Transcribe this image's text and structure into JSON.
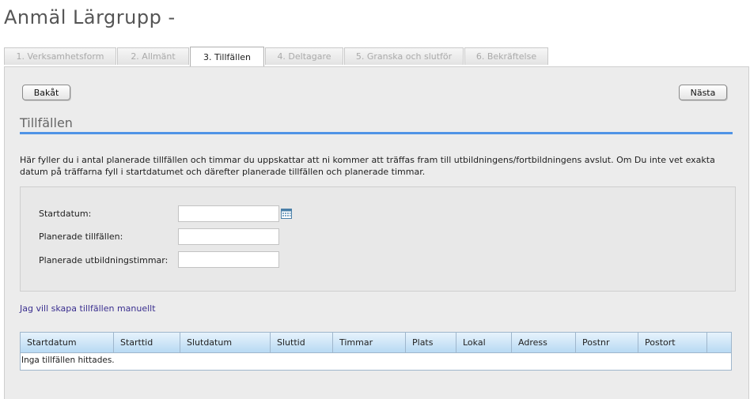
{
  "page": {
    "title": "Anmäl Lärgrupp -"
  },
  "tabs": [
    {
      "label": "1. Verksamhetsform",
      "active": false
    },
    {
      "label": "2. Allmänt",
      "active": false
    },
    {
      "label": "3. Tillfällen",
      "active": true
    },
    {
      "label": "4. Deltagare",
      "active": false
    },
    {
      "label": "5. Granska och slutför",
      "active": false
    },
    {
      "label": "6. Bekräftelse",
      "active": false
    }
  ],
  "nav": {
    "back_label": "Bakåt",
    "next_label": "Nästa"
  },
  "section": {
    "title": "Tillfällen",
    "intro": "Här fyller du i antal planerade tillfällen och timmar du uppskattar att ni kommer att träffas fram till utbildningens/fortbildningens avslut. Om Du inte vet exakta datum på träffarna fyll i startdatumet och därefter planerade tillfällen och planerade timmar."
  },
  "form": {
    "start_date_label": "Startdatum:",
    "start_date_value": "",
    "planned_sessions_label": "Planerade tillfällen:",
    "planned_sessions_value": "",
    "planned_hours_label": "Planerade utbildningstimmar:",
    "planned_hours_value": "",
    "calendar_icon": "calendar-icon"
  },
  "manual_link": "Jag vill skapa tillfällen manuellt",
  "grid": {
    "columns": [
      "Startdatum",
      "Starttid",
      "Slutdatum",
      "Sluttid",
      "Timmar",
      "Plats",
      "Lokal",
      "Adress",
      "Postnr",
      "Postort",
      ""
    ],
    "empty_text": "Inga tillfällen hittades."
  },
  "colors": {
    "accent": "#4f94e6",
    "link": "#3a2f8f",
    "grid_header": "#b8daf3"
  }
}
